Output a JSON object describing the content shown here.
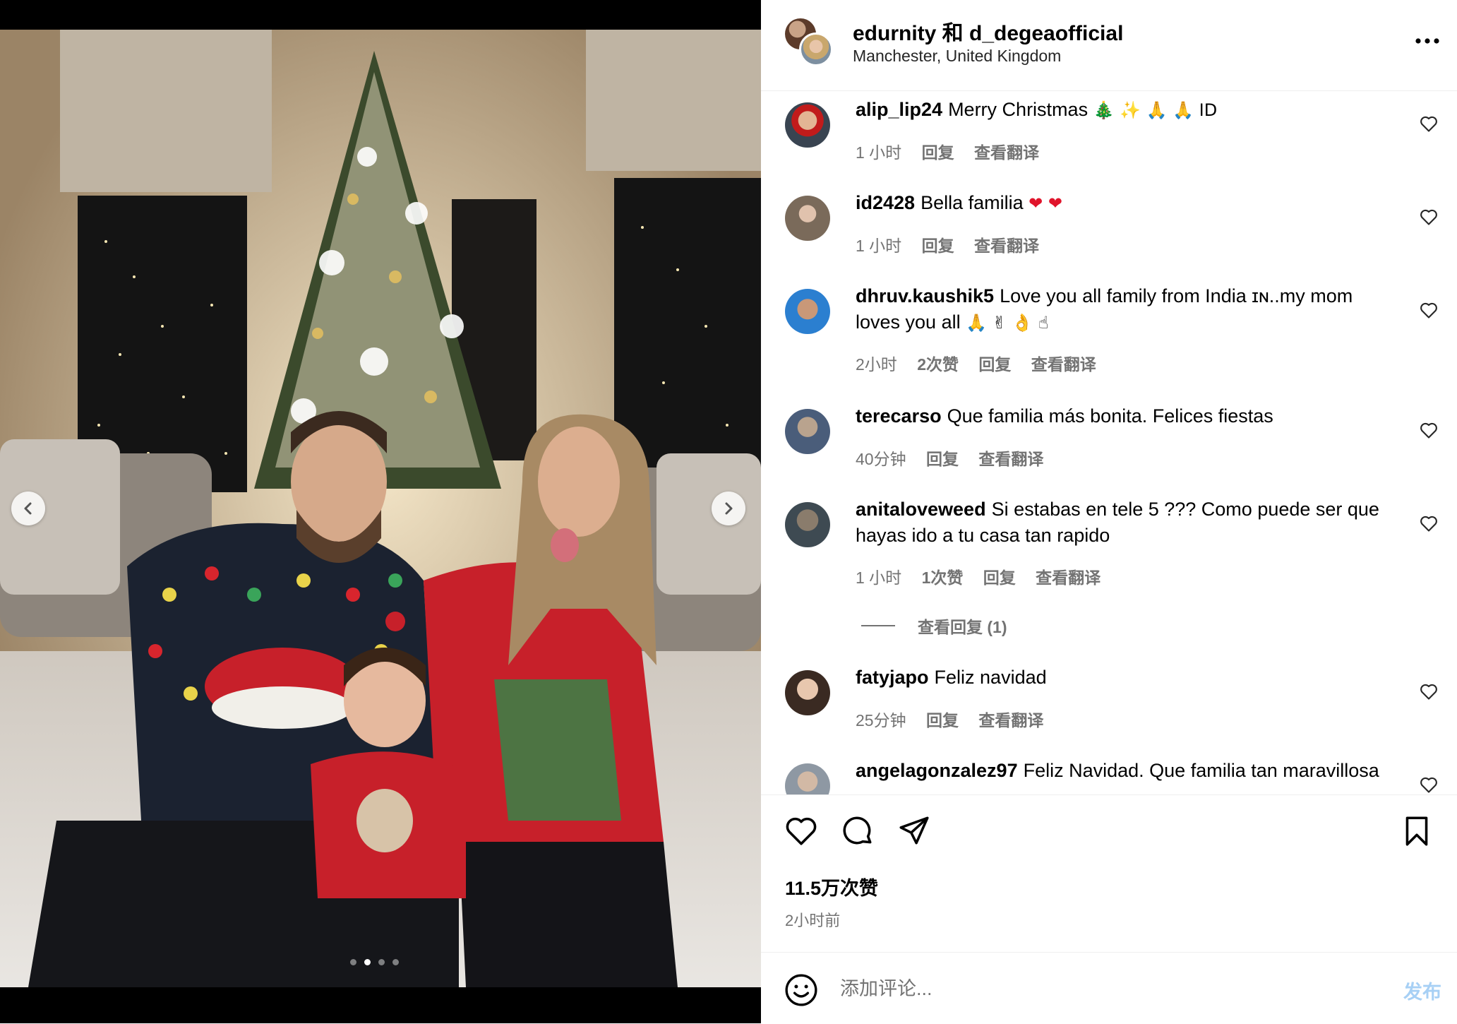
{
  "post": {
    "authors": "edurnity 和 d_degeaofficial",
    "location": "Manchester, United Kingdom",
    "likes": "11.5万次赞",
    "time": "2小时前",
    "carousel": {
      "total_slides": 4,
      "active_slide": 2
    }
  },
  "comments": [
    {
      "user": "alip_lip24",
      "text": "Merry Christmas",
      "emoji": "🎄 ✨ 🙏 🙏 ID",
      "time": "1 小时",
      "likes": "",
      "reply": "回复",
      "translate": "查看翻译"
    },
    {
      "user": "id2428",
      "text": "Bella familia",
      "emoji": "❤ ❤",
      "time": "1 小时",
      "likes": "",
      "reply": "回复",
      "translate": "查看翻译"
    },
    {
      "user": "dhruv.kaushik5",
      "text": "Love you all family from India ɪɴ..my mom loves you all",
      "emoji": "🙏 ✌ 👌 ☝",
      "time": "2小时",
      "likes": "2次赞",
      "reply": "回复",
      "translate": "查看翻译"
    },
    {
      "user": "terecarso",
      "text": "Que familia más bonita. Felices fiestas",
      "emoji": "",
      "time": "40分钟",
      "likes": "",
      "reply": "回复",
      "translate": "查看翻译"
    },
    {
      "user": "anitaloveweed",
      "text": "Si estabas en tele 5 ??? Como puede ser que hayas ido a tu casa tan rapido",
      "emoji": "",
      "time": "1 小时",
      "likes": "1次赞",
      "reply": "回复",
      "translate": "查看翻译",
      "view_replies": "查看回复 (1)"
    },
    {
      "user": "fatyjapo",
      "text": "Feliz navidad",
      "emoji": "",
      "time": "25分钟",
      "likes": "",
      "reply": "回复",
      "translate": "查看翻译"
    },
    {
      "user": "angelagonzalez97",
      "text": "Feliz Navidad. Que familia tan maravillosa",
      "emoji": "",
      "time": "",
      "likes": "",
      "reply": "",
      "translate": ""
    }
  ],
  "comment_box": {
    "placeholder": "添加评论...",
    "post_label": "发布"
  },
  "icons": {
    "more": "more-options-icon",
    "like": "heart-icon",
    "comment": "comment-icon",
    "share": "send-icon",
    "save": "bookmark-icon",
    "emoji": "emoji-icon",
    "prev": "chevron-left-icon",
    "next": "chevron-right-icon"
  },
  "colors": {
    "post_button": "#a7d0f5",
    "meta_text": "#737373",
    "heart_red": "#e0142b"
  }
}
